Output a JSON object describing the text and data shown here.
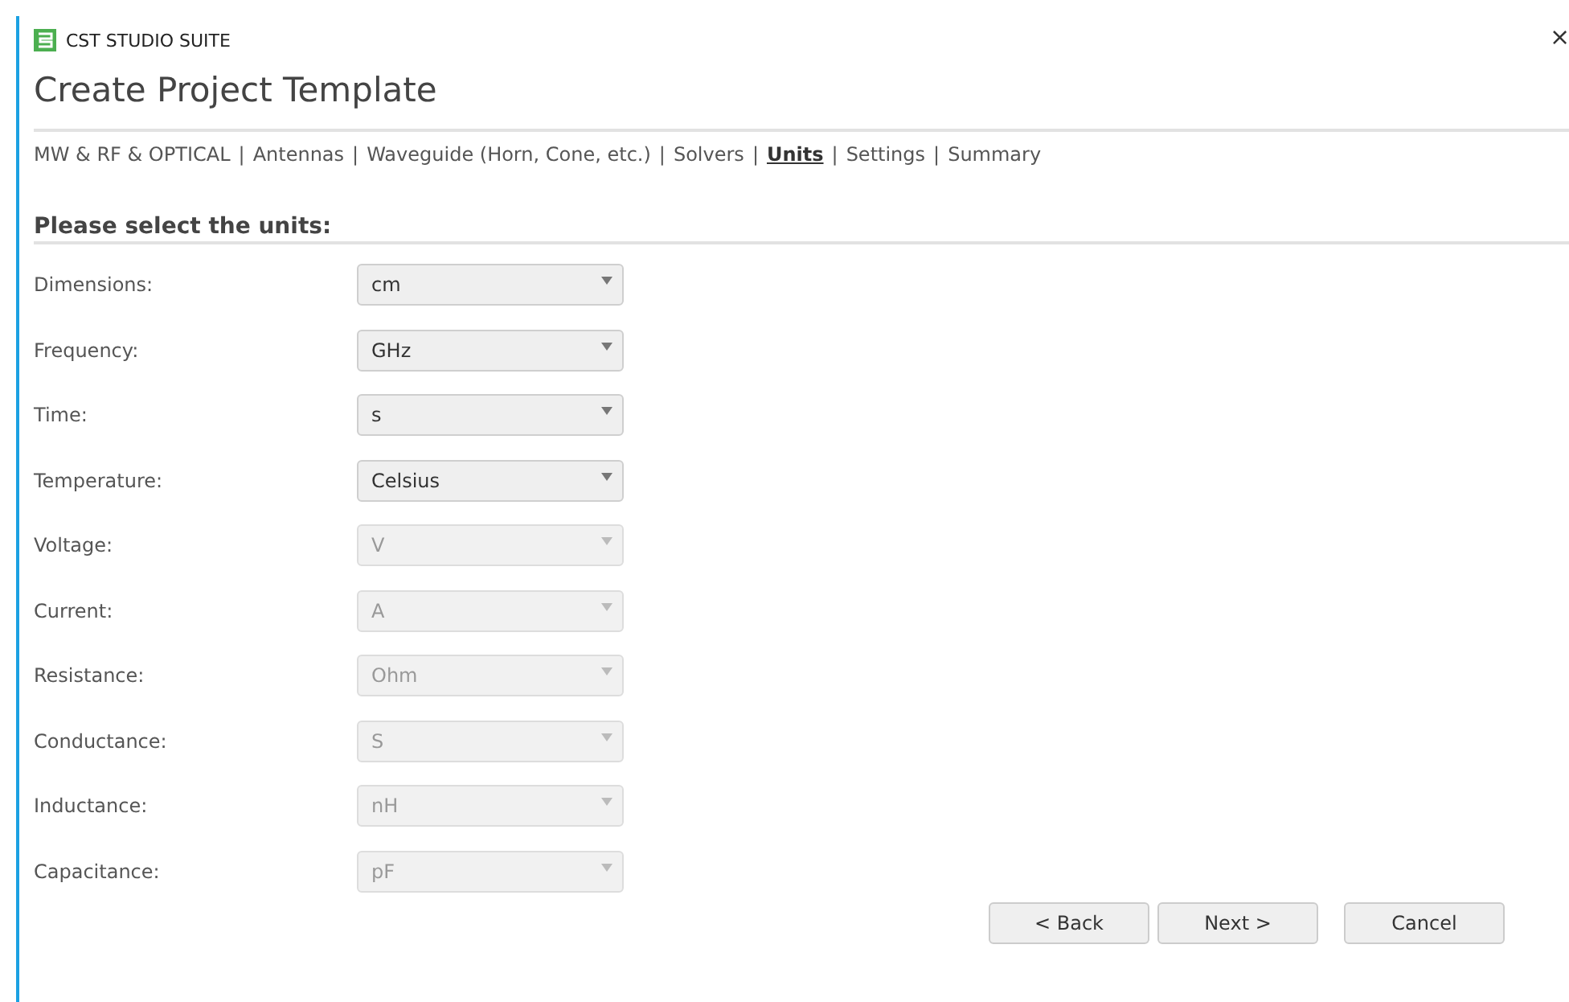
{
  "window": {
    "app_name": "CST STUDIO SUITE",
    "close": "×"
  },
  "title": "Create Project Template",
  "breadcrumbs": {
    "separator": "|",
    "items": [
      {
        "label": "MW & RF & OPTICAL",
        "selected": false
      },
      {
        "label": "Antennas",
        "selected": false
      },
      {
        "label": "Waveguide (Horn, Cone, etc.)",
        "selected": false
      },
      {
        "label": "Solvers",
        "selected": false
      },
      {
        "label": "Units",
        "selected": true
      },
      {
        "label": "Settings",
        "selected": false
      },
      {
        "label": "Summary",
        "selected": false
      }
    ]
  },
  "section_heading": "Please select the units:",
  "units": [
    {
      "label": "Dimensions:",
      "value": "cm",
      "disabled": false
    },
    {
      "label": "Frequency:",
      "value": "GHz",
      "disabled": false
    },
    {
      "label": "Time:",
      "value": "s",
      "disabled": false
    },
    {
      "label": "Temperature:",
      "value": "Celsius",
      "disabled": false
    },
    {
      "label": "Voltage:",
      "value": "V",
      "disabled": true
    },
    {
      "label": "Current:",
      "value": "A",
      "disabled": true
    },
    {
      "label": "Resistance:",
      "value": "Ohm",
      "disabled": true
    },
    {
      "label": "Conductance:",
      "value": "S",
      "disabled": true
    },
    {
      "label": "Inductance:",
      "value": "nH",
      "disabled": true
    },
    {
      "label": "Capacitance:",
      "value": "pF",
      "disabled": true
    }
  ],
  "buttons": [
    "< Back",
    "Next >",
    "Cancel"
  ]
}
